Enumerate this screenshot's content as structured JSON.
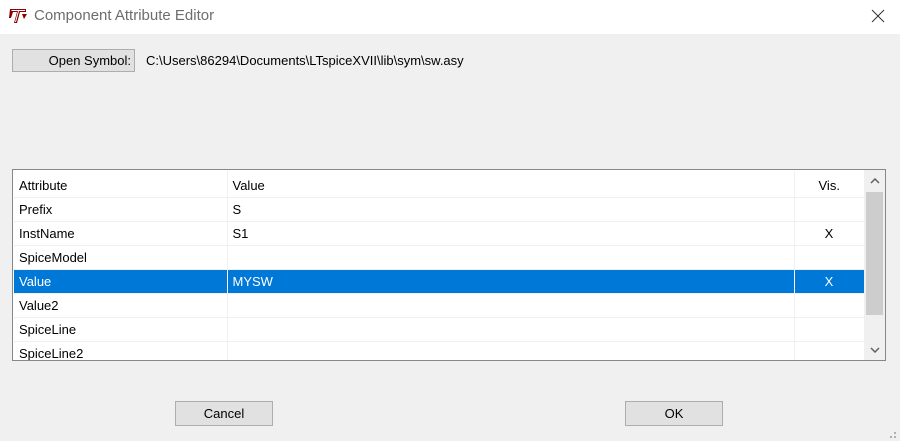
{
  "window": {
    "title": "Component Attribute Editor",
    "app_icon": "ltspice-logo-icon",
    "close_icon": "close-icon"
  },
  "symbol": {
    "open_button_label": "Open Symbol:",
    "path": "C:\\Users\\86294\\Documents\\LTspiceXVII\\lib\\sym\\sw.asy"
  },
  "table": {
    "headers": {
      "attribute": "Attribute",
      "value": "Value",
      "vis": "Vis."
    },
    "rows": [
      {
        "attribute": "Prefix",
        "value": "S",
        "vis": ""
      },
      {
        "attribute": "InstName",
        "value": "S1",
        "vis": "X"
      },
      {
        "attribute": "SpiceModel",
        "value": "",
        "vis": ""
      },
      {
        "attribute": "Value",
        "value": "MYSW",
        "vis": "X",
        "selected": true
      },
      {
        "attribute": "Value2",
        "value": "",
        "vis": ""
      },
      {
        "attribute": "SpiceLine",
        "value": "",
        "vis": ""
      },
      {
        "attribute": "SpiceLine2",
        "value": "",
        "vis": ""
      }
    ],
    "selection_color": "#0078d7"
  },
  "footer": {
    "cancel_label": "Cancel",
    "ok_label": "OK"
  }
}
